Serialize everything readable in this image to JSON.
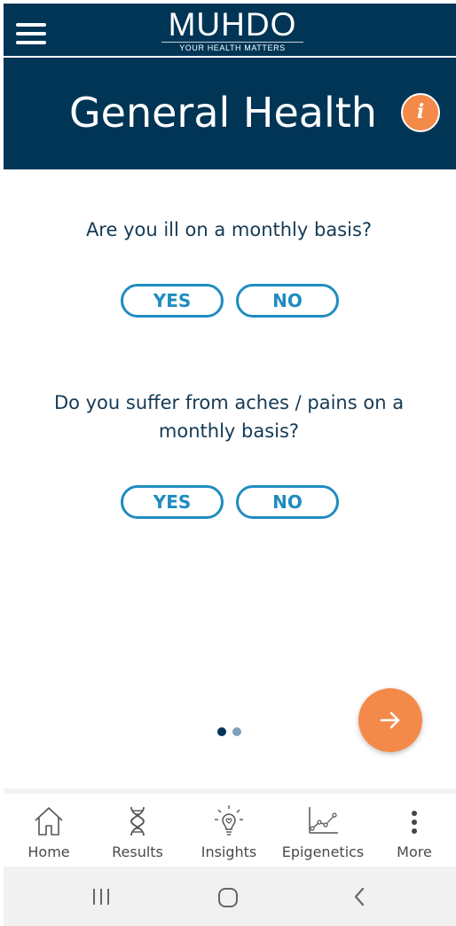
{
  "header": {
    "logo_word": "MUHDO",
    "logo_tagline": "YOUR HEALTH MATTERS",
    "menu_icon": "hamburger-menu-icon"
  },
  "title_band": {
    "title": "General Health",
    "info_icon": "info-icon",
    "info_glyph": "i"
  },
  "questions": [
    {
      "text": "Are you ill on a monthly basis?",
      "yes_label": "YES",
      "no_label": "NO"
    },
    {
      "text": "Do you suffer from aches / pains on a monthly basis?",
      "yes_label": "YES",
      "no_label": "NO"
    }
  ],
  "pager": {
    "total": 2,
    "current": 1
  },
  "next_button": {
    "icon": "arrow-right-icon"
  },
  "bottom_nav": [
    {
      "label": "Home",
      "icon": "home-icon"
    },
    {
      "label": "Results",
      "icon": "dna-icon"
    },
    {
      "label": "Insights",
      "icon": "lightbulb-icon"
    },
    {
      "label": "Epigenetics",
      "icon": "chart-line-icon"
    },
    {
      "label": "More",
      "icon": "more-vertical-icon"
    }
  ],
  "system_nav": [
    "recent-apps-icon",
    "home-circle-icon",
    "back-icon"
  ],
  "colors": {
    "header_bg": "#003556",
    "accent_orange": "#f38a4a",
    "button_blue": "#1f8cc0",
    "question_text": "#143a55",
    "system_bar": "#f1f1f1"
  }
}
